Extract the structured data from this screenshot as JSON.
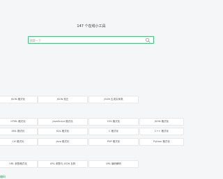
{
  "header": {
    "title": "147 个在线小工具"
  },
  "search": {
    "placeholder": "搜索一下"
  },
  "row1": [
    "JSON 格式化",
    "JSON 校正",
    "JSON 生成实体类"
  ],
  "row2": [
    "HTML 格式化",
    "JavaScript 格式化",
    "CSS 格式化",
    "JSON 格式化"
  ],
  "row3": [
    "XML 格式化",
    "SQL 格式化",
    "C 格式化",
    "C++ 格式化"
  ],
  "row4": [
    "C# 格式化",
    "Java 格式化",
    "PHP 格式化",
    "Python 格式化"
  ],
  "row5": [
    "URL 参数格式化",
    "URL 参数与 JSON 互转",
    "URL 编码解码"
  ],
  "footer": {
    "tail_text": "编码"
  }
}
